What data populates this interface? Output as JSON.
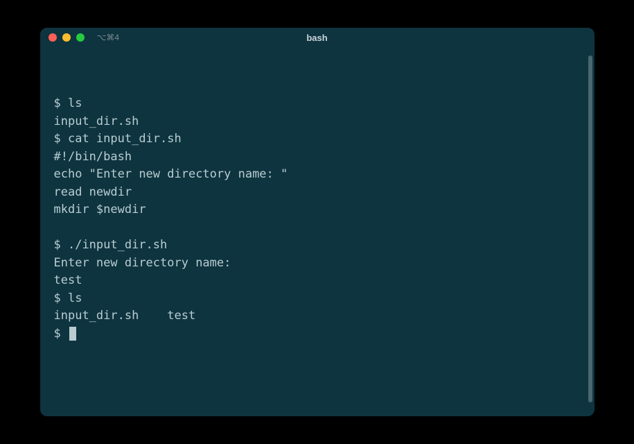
{
  "titlebar": {
    "tab_label": "⌥⌘4",
    "title": "bash"
  },
  "prompt": "$ ",
  "lines": [
    {
      "type": "cmd",
      "text": "ls"
    },
    {
      "type": "out",
      "text": "input_dir.sh"
    },
    {
      "type": "cmd",
      "text": "cat input_dir.sh"
    },
    {
      "type": "out",
      "text": "#!/bin/bash"
    },
    {
      "type": "out",
      "text": "echo \"Enter new directory name: \""
    },
    {
      "type": "out",
      "text": "read newdir"
    },
    {
      "type": "out",
      "text": "mkdir $newdir"
    },
    {
      "type": "blank",
      "text": ""
    },
    {
      "type": "cmd",
      "text": "./input_dir.sh"
    },
    {
      "type": "out",
      "text": "Enter new directory name:"
    },
    {
      "type": "out",
      "text": "test"
    },
    {
      "type": "cmd",
      "text": "ls"
    },
    {
      "type": "out",
      "text": "input_dir.sh    test"
    },
    {
      "type": "prompt-cursor",
      "text": ""
    }
  ],
  "colors": {
    "background": "#0e3440",
    "foreground": "#b9cdd1"
  }
}
